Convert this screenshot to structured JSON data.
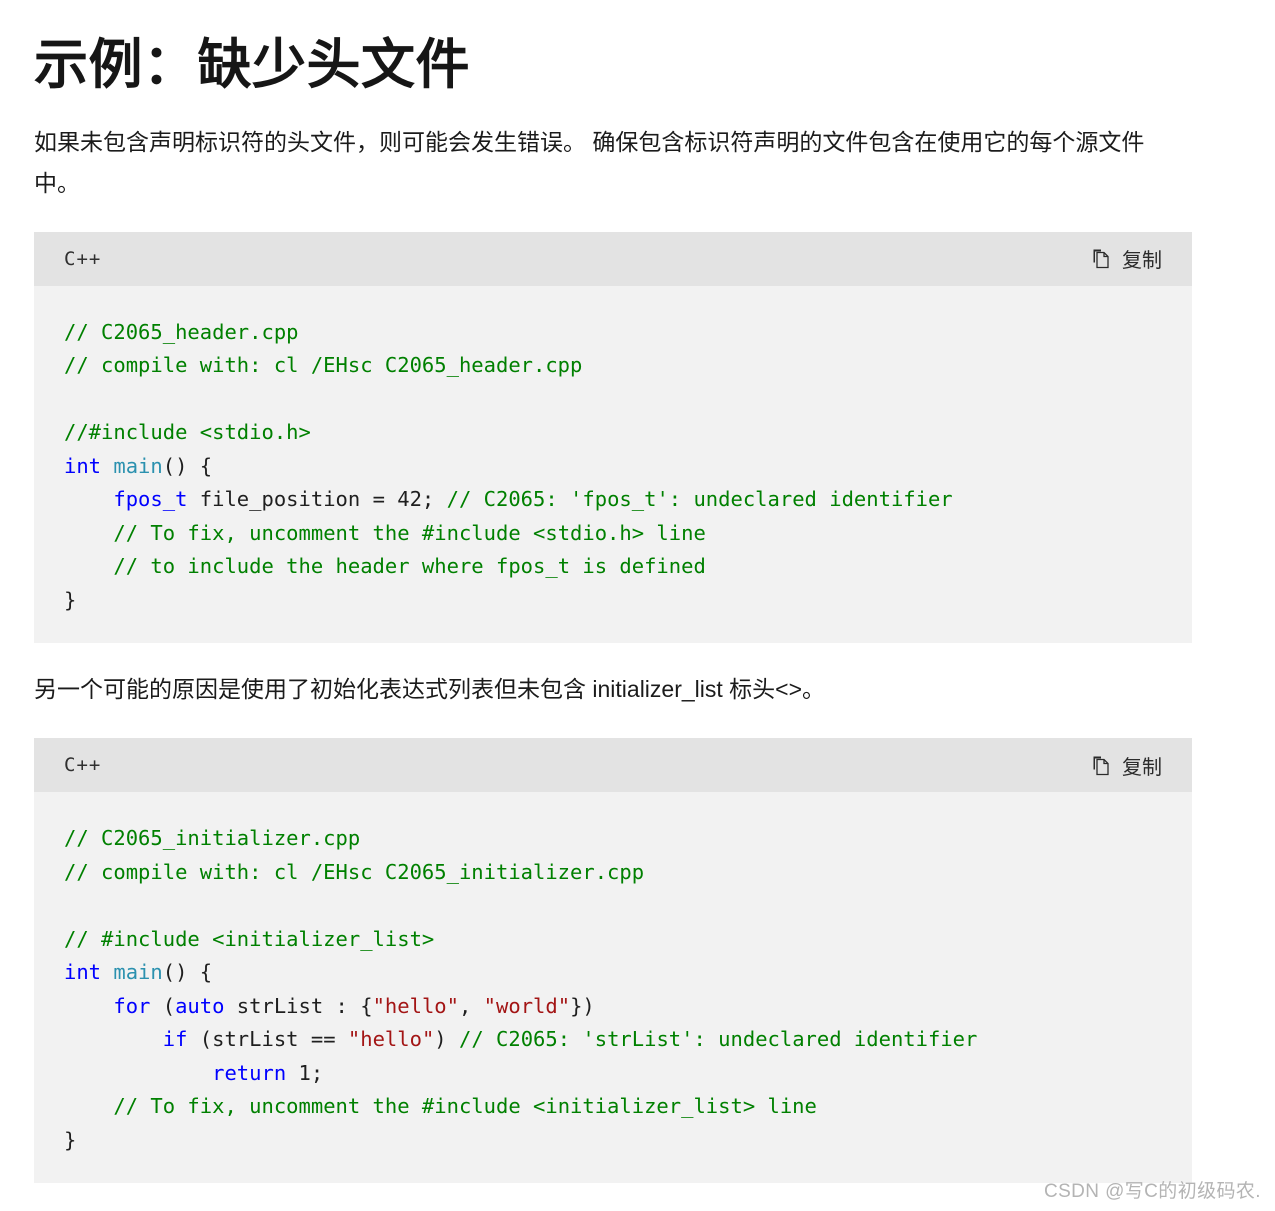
{
  "page": {
    "title": "示例：缺少头文件",
    "paragraph_1": "如果未包含声明标识符的头文件，则可能会发生错误。 确保包含标识符声明的文件包含在使用它的每个源文件中。",
    "paragraph_2": "另一个可能的原因是使用了初始化表达式列表但未包含 initializer_list 标头<>。",
    "watermark": "CSDN @写C的初级码农."
  },
  "colors": {
    "page_background": "#ffffff",
    "code_background": "#f2f2f2",
    "code_header_background": "#e3e3e3",
    "text": "#171717",
    "comment_green": "#008000",
    "keyword_blue": "#0000ff",
    "type_teal": "#2b91af",
    "string_red": "#a31515",
    "watermark_gray": "#b4b4b4"
  },
  "code_blocks": [
    {
      "language_label": "C++",
      "copy_label": "复制",
      "copy_icon": "copy-icon",
      "lines": [
        [
          {
            "t": "// C2065_header.cpp",
            "c": "cm"
          }
        ],
        [
          {
            "t": "// compile with: cl /EHsc C2065_header.cpp",
            "c": "cm"
          }
        ],
        [
          {
            "t": "",
            "c": "pl"
          }
        ],
        [
          {
            "t": "//#include <stdio.h>",
            "c": "cm"
          }
        ],
        [
          {
            "t": "int",
            "c": "kw"
          },
          {
            "t": " ",
            "c": "pl"
          },
          {
            "t": "main",
            "c": "ty"
          },
          {
            "t": "() {",
            "c": "pl"
          }
        ],
        [
          {
            "t": "    ",
            "c": "pl"
          },
          {
            "t": "fpos_t",
            "c": "kw"
          },
          {
            "t": " file_position = 42; ",
            "c": "pl"
          },
          {
            "t": "// C2065: 'fpos_t': undeclared identifier",
            "c": "cm"
          }
        ],
        [
          {
            "t": "    ",
            "c": "pl"
          },
          {
            "t": "// To fix, uncomment the #include <stdio.h> line",
            "c": "cm"
          }
        ],
        [
          {
            "t": "    ",
            "c": "pl"
          },
          {
            "t": "// to include the header where fpos_t is defined",
            "c": "cm"
          }
        ],
        [
          {
            "t": "}",
            "c": "pl"
          }
        ]
      ]
    },
    {
      "language_label": "C++",
      "copy_label": "复制",
      "copy_icon": "copy-icon",
      "lines": [
        [
          {
            "t": "// C2065_initializer.cpp",
            "c": "cm"
          }
        ],
        [
          {
            "t": "// compile with: cl /EHsc C2065_initializer.cpp",
            "c": "cm"
          }
        ],
        [
          {
            "t": "",
            "c": "pl"
          }
        ],
        [
          {
            "t": "// #include <initializer_list>",
            "c": "cm"
          }
        ],
        [
          {
            "t": "int",
            "c": "kw"
          },
          {
            "t": " ",
            "c": "pl"
          },
          {
            "t": "main",
            "c": "ty"
          },
          {
            "t": "() {",
            "c": "pl"
          }
        ],
        [
          {
            "t": "    ",
            "c": "pl"
          },
          {
            "t": "for",
            "c": "kw"
          },
          {
            "t": " (",
            "c": "pl"
          },
          {
            "t": "auto",
            "c": "kw"
          },
          {
            "t": " strList : {",
            "c": "pl"
          },
          {
            "t": "\"hello\"",
            "c": "st"
          },
          {
            "t": ", ",
            "c": "pl"
          },
          {
            "t": "\"world\"",
            "c": "st"
          },
          {
            "t": "})",
            "c": "pl"
          }
        ],
        [
          {
            "t": "        ",
            "c": "pl"
          },
          {
            "t": "if",
            "c": "kw"
          },
          {
            "t": " (strList == ",
            "c": "pl"
          },
          {
            "t": "\"hello\"",
            "c": "st"
          },
          {
            "t": ") ",
            "c": "pl"
          },
          {
            "t": "// C2065: 'strList': undeclared identifier",
            "c": "cm"
          }
        ],
        [
          {
            "t": "            ",
            "c": "pl"
          },
          {
            "t": "return",
            "c": "kw"
          },
          {
            "t": " 1;",
            "c": "pl"
          }
        ],
        [
          {
            "t": "    ",
            "c": "pl"
          },
          {
            "t": "// To fix, uncomment the #include <initializer_list> line",
            "c": "cm"
          }
        ],
        [
          {
            "t": "}",
            "c": "pl"
          }
        ]
      ]
    }
  ]
}
